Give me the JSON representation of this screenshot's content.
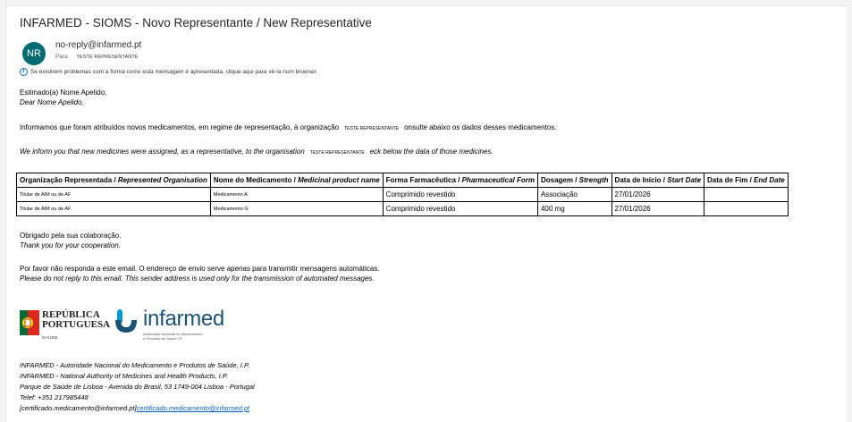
{
  "email": {
    "subject": "INFARMED - SIOMS - Novo Representante / New Representative",
    "avatar_initials": "NR",
    "sender": "no-reply@infarmed.pt",
    "to_label": "Para",
    "to_name": "TESTE REPRESENTANTE",
    "info_notice": "Se existirem problemas com a forma como esta mensagem é apresentada, clique aqui para vê-la num browser."
  },
  "body": {
    "greeting_pt": "Estimado(a) Nome Apelido,",
    "greeting_en": "Dear Nome Apelido,",
    "para_pt_before": "Informamos que foram atribuídos novos medicamentos, em regime de representação, à organização",
    "para_pt_tag": "TESTE REPRESENTANTE",
    "para_pt_after": "onsulte abaixo os dados desses medicamentos.",
    "para_en_before": "We inform you that new medicines were assigned, as a representative, to the organisation",
    "para_en_tag": "TESTE REPRESENTANTE",
    "para_en_after": "eck below the data of those medicines.",
    "thanks_pt": "Obrigado pela sua colaboração.",
    "thanks_en": "Thank you for your cooperation.",
    "noreply_pt": "Por favor não responda a este email. O endereço de envio serve apenas para transmitir mensagens automáticas.",
    "noreply_en": "Please do not reply to this email. This sender address is used only for the transmission of automated messages."
  },
  "table": {
    "headers": [
      {
        "pt": "Organização Representada / ",
        "en": "Represented Organisation"
      },
      {
        "pt": "Nome do Medicamento / ",
        "en": "Medicinal product name"
      },
      {
        "pt": "Forma Farmacêutica / ",
        "en": "Pharmaceutical Form"
      },
      {
        "pt": "Dosagem / ",
        "en": "Strength"
      },
      {
        "pt": "Data de Início / ",
        "en": "Start Date"
      },
      {
        "pt": "Data de Fim / ",
        "en": "End Date"
      }
    ],
    "rows": [
      [
        "Titular de AIM ou de AF",
        "Medicamento A",
        "Comprimido revestido",
        "Associação",
        "27/01/2026",
        ""
      ],
      [
        "Titular de AIM ou de AF",
        "Medicamento G",
        "Comprimido revestido",
        "400 mg",
        "27/01/2026",
        ""
      ]
    ]
  },
  "logos": {
    "republica_line1": "REPÚBLICA",
    "republica_line2": "PORTUGUESA",
    "republica_sub": "SAÚDE",
    "infarmed_name": "infarmed",
    "infarmed_sub": "Autoridade Nacional do Medicamento e Produtos de Saúde I.P."
  },
  "footer": {
    "line1": "INFARMED - Autoridade Nacional do Medicamento e Produtos de Saúde, I.P.",
    "line2": "INFARMED - National Authority of Medicines and Health Products, I.P.",
    "line3": "Parque de Saúde de Lisboa - Avenida do Brasil, 53 1749-004 Lisboa - Portugal",
    "line4": "Telef: +351 217985448",
    "email_prefix": "[certificado.medicamento@infarmed.pt]",
    "email_link": "certificado.medicamento@infarmed.pt"
  },
  "colors": {
    "avatar": "#036c70",
    "link": "#0563c1",
    "infarmed_blue": "#1a5276",
    "infarmed_cyan": "#0099d8"
  }
}
